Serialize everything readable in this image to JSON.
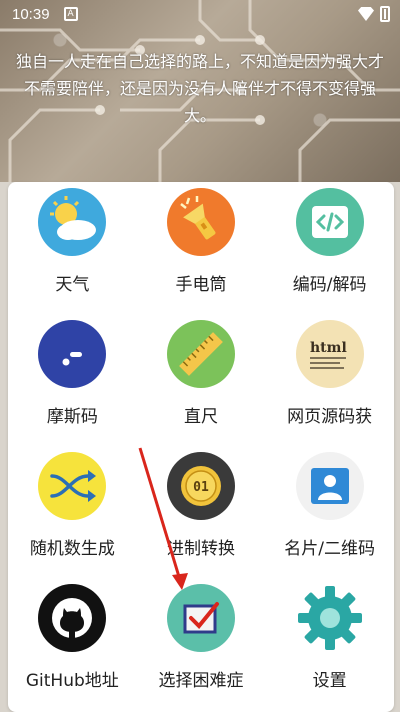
{
  "status_bar": {
    "time": "10:39",
    "sim_letter": "A"
  },
  "quote": "独自一人走在自己选择的路上，不知道是因为强大才不需要陪伴，还是因为没有人陪伴才不得不变得强大。",
  "tiles": [
    {
      "label": "天气",
      "icon": "weather-icon"
    },
    {
      "label": "手电筒",
      "icon": "flashlight-icon"
    },
    {
      "label": "编码/解码",
      "icon": "code-icon"
    },
    {
      "label": "摩斯码",
      "icon": "morse-icon"
    },
    {
      "label": "直尺",
      "icon": "ruler-icon"
    },
    {
      "label": "网页源码获",
      "icon": "html-source-icon",
      "icon_text": "html"
    },
    {
      "label": "随机数生成",
      "icon": "shuffle-icon"
    },
    {
      "label": "进制转换",
      "icon": "base-convert-icon",
      "icon_text": "01"
    },
    {
      "label": "名片/二维码",
      "icon": "card-icon"
    },
    {
      "label": "GitHub地址",
      "icon": "github-icon"
    },
    {
      "label": "选择困难症",
      "icon": "checkbox-icon"
    },
    {
      "label": "设置",
      "icon": "gear-icon"
    }
  ],
  "colors": {
    "weather": "#3fa9dd",
    "flashlight": "#f07a2c",
    "code": "#54bfa0",
    "morse": "#2f43a6",
    "ruler": "#7cc25a",
    "html": "#f3e2b4",
    "shuffle": "#f6e33c",
    "base": "#3a3a3a",
    "card": "#f1f1f1",
    "github": "#111111",
    "checkbox": "#5bbfa9",
    "gear": "#2aa7a4",
    "arrow": "#d9261c"
  }
}
